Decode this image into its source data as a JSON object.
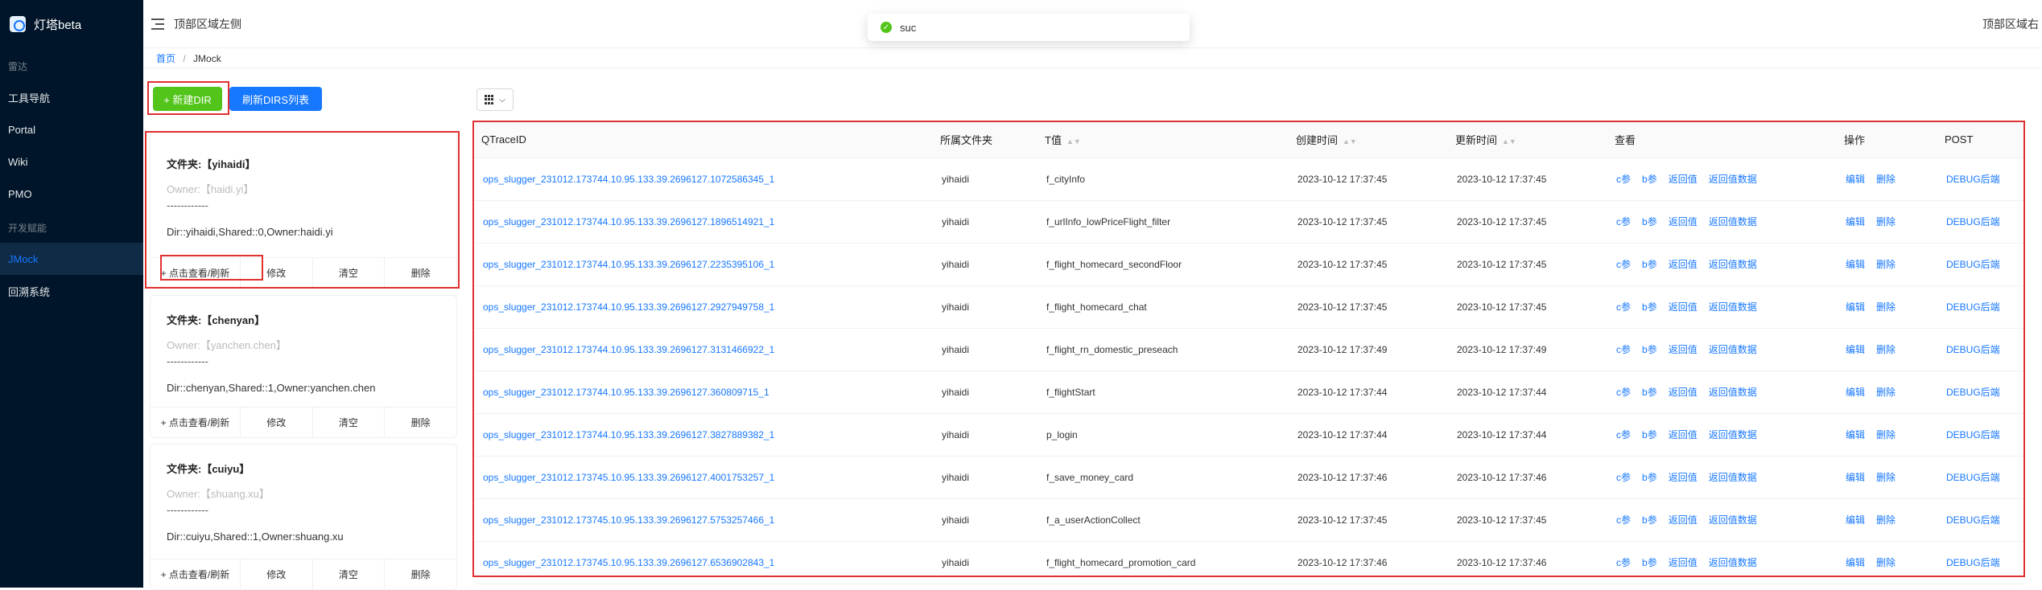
{
  "app": {
    "title": "灯塔beta"
  },
  "sidebar": {
    "items": [
      {
        "type": "group",
        "label": "雷达"
      },
      {
        "type": "item",
        "label": "工具导航"
      },
      {
        "type": "item",
        "label": "Portal"
      },
      {
        "type": "item",
        "label": "Wiki"
      },
      {
        "type": "item",
        "label": "PMO"
      },
      {
        "type": "group",
        "label": "开发赋能"
      },
      {
        "type": "item",
        "label": "JMock",
        "active": true
      },
      {
        "type": "item",
        "label": "回溯系统"
      }
    ]
  },
  "header": {
    "left": "顶部区域左侧",
    "right": "顶部区域右"
  },
  "toast": {
    "text": "suc",
    "color": "#52c41a"
  },
  "breadcrumb": {
    "home": "首页",
    "sep": "/",
    "current": "JMock"
  },
  "toolbar": {
    "new_dir": "+ 新建DIR",
    "refresh_dirs": "刷新DIRS列表"
  },
  "dirs": [
    {
      "title": "文件夹:【yihaidi】",
      "owner": "Owner:【haidi.yi】",
      "dash": "------------",
      "desc": "Dir::yihaidi,Shared::0,Owner:haidi.yi",
      "actions": [
        "+ 点击查看/刷新",
        "修改",
        "清空",
        "删除"
      ]
    },
    {
      "title": "文件夹:【chenyan】",
      "owner": "Owner:【yanchen.chen】",
      "dash": "------------",
      "desc": "Dir::chenyan,Shared::1,Owner:yanchen.chen",
      "actions": [
        "+ 点击查看/刷新",
        "修改",
        "清空",
        "删除"
      ]
    },
    {
      "title": "文件夹:【cuiyu】",
      "owner": "Owner:【shuang.xu】",
      "dash": "------------",
      "desc": "Dir::cuiyu,Shared::1,Owner:shuang.xu",
      "actions": [
        "+ 点击查看/刷新",
        "修改",
        "清空",
        "删除"
      ]
    }
  ],
  "table": {
    "columns": [
      "QTraceID",
      "所属文件夹",
      "T值",
      "创建时间",
      "更新时间",
      "查看",
      "操作",
      "POST"
    ],
    "view_links": [
      "c参",
      "b参",
      "返回值",
      "返回值数据"
    ],
    "op_links": [
      "编辑",
      "删除"
    ],
    "post_link": "DEBUG后端",
    "rows": [
      {
        "trace": "ops_slugger_231012.173744.10.95.133.39.2696127.1072586345_1",
        "folder": "yihaidi",
        "t": "f_cityInfo",
        "created": "2023-10-12 17:37:45",
        "updated": "2023-10-12 17:37:45"
      },
      {
        "trace": "ops_slugger_231012.173744.10.95.133.39.2696127.1896514921_1",
        "folder": "yihaidi",
        "t": "f_urlInfo_lowPriceFlight_filter",
        "created": "2023-10-12 17:37:45",
        "updated": "2023-10-12 17:37:45"
      },
      {
        "trace": "ops_slugger_231012.173744.10.95.133.39.2696127.2235395106_1",
        "folder": "yihaidi",
        "t": "f_flight_homecard_secondFloor",
        "created": "2023-10-12 17:37:45",
        "updated": "2023-10-12 17:37:45"
      },
      {
        "trace": "ops_slugger_231012.173744.10.95.133.39.2696127.2927949758_1",
        "folder": "yihaidi",
        "t": "f_flight_homecard_chat",
        "created": "2023-10-12 17:37:45",
        "updated": "2023-10-12 17:37:45"
      },
      {
        "trace": "ops_slugger_231012.173744.10.95.133.39.2696127.3131466922_1",
        "folder": "yihaidi",
        "t": "f_flight_rn_domestic_preseach",
        "created": "2023-10-12 17:37:49",
        "updated": "2023-10-12 17:37:49"
      },
      {
        "trace": "ops_slugger_231012.173744.10.95.133.39.2696127.360809715_1",
        "folder": "yihaidi",
        "t": "f_flightStart",
        "created": "2023-10-12 17:37:44",
        "updated": "2023-10-12 17:37:44"
      },
      {
        "trace": "ops_slugger_231012.173744.10.95.133.39.2696127.3827889382_1",
        "folder": "yihaidi",
        "t": "p_login",
        "created": "2023-10-12 17:37:44",
        "updated": "2023-10-12 17:37:44"
      },
      {
        "trace": "ops_slugger_231012.173745.10.95.133.39.2696127.4001753257_1",
        "folder": "yihaidi",
        "t": "f_save_money_card",
        "created": "2023-10-12 17:37:46",
        "updated": "2023-10-12 17:37:46"
      },
      {
        "trace": "ops_slugger_231012.173745.10.95.133.39.2696127.5753257466_1",
        "folder": "yihaidi",
        "t": "f_a_userActionCollect",
        "created": "2023-10-12 17:37:45",
        "updated": "2023-10-12 17:37:45"
      },
      {
        "trace": "ops_slugger_231012.173745.10.95.133.39.2696127.6536902843_1",
        "folder": "yihaidi",
        "t": "f_flight_homecard_promotion_card",
        "created": "2023-10-12 17:37:46",
        "updated": "2023-10-12 17:37:46"
      }
    ]
  }
}
